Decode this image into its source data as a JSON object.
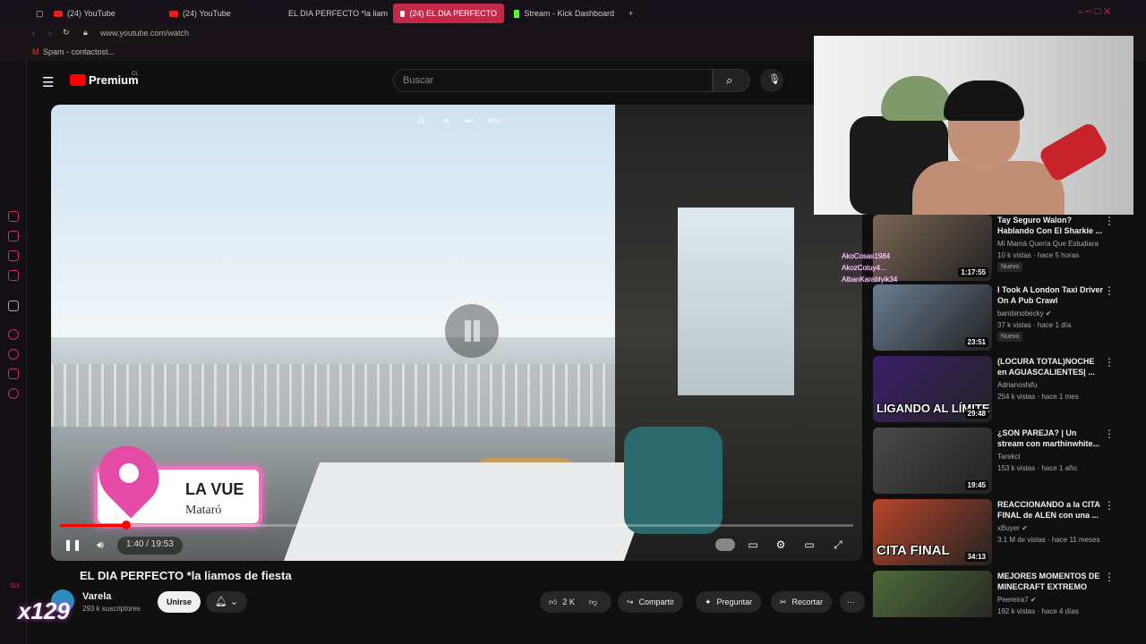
{
  "browser": {
    "tabs": [
      {
        "label": "(24) YouTube"
      },
      {
        "label": "(24) YouTube"
      },
      {
        "label": "EL DIA PERFECTO *la liam"
      },
      {
        "label": "(24) EL DIA PERFECTO"
      },
      {
        "label": "Stream - Kick Dashboard"
      }
    ],
    "new_tab": "+",
    "url": "www.youtube.com/watch",
    "bookmark": "Spam - contactost..."
  },
  "youtube": {
    "logo": "Premium",
    "country": "CL",
    "search_placeholder": "Buscar"
  },
  "video": {
    "location_name": "LA VUE",
    "location_city": "Mataró",
    "time": "1:40 / 19:53",
    "progress": 0.084,
    "mini_label": "RGX"
  },
  "below": {
    "title": "EL DIA PERFECTO *la liamos de fiesta",
    "channel": "Varela",
    "subscribers": "293 k suscriptores",
    "join": "Unirse",
    "likes": "2 K",
    "share": "Compartir",
    "ask": "Preguntar",
    "clip": "Recortar",
    "more": "⋯"
  },
  "overlay": {
    "counter": "x129",
    "gx": "GX",
    "chat": [
      "AkoCosas1984",
      "AkozCotuy4...",
      "AlbanKarablyik34"
    ]
  },
  "related": [
    {
      "title": "Tay Seguro Walon? Hablando Con El Sharkie ...",
      "channel": "Mi Mamá Quería Que Estudiara",
      "meta": "10 k vistas · hace 5 horas",
      "badge": "Nuevo",
      "duration": "1:17:55",
      "overlay": "",
      "color": "#7a6655"
    },
    {
      "title": "I Took A London Taxi Driver On A Pub Crawl",
      "channel": "bambinobecky ✔",
      "meta": "37 k vistas · hace 1 día",
      "badge": "Nuevo",
      "duration": "23:51",
      "overlay": "",
      "color": "#6b7d93"
    },
    {
      "title": "(LOCURA TOTAL)NOCHE en AGUASCALIENTES| ...",
      "channel": "Adrianoshifu",
      "meta": "254 k vistas · hace 1 mes",
      "badge": "",
      "duration": "29:48",
      "overlay": "LIGANDO AL LÍMITE",
      "color": "#3b1f6b"
    },
    {
      "title": "¿SON PAREJA? | Un stream con marthinwhite...",
      "channel": "Tarekcl",
      "meta": "153 k vistas · hace 1 año",
      "badge": "",
      "duration": "19:45",
      "overlay": "",
      "color": "#4a4a4a"
    },
    {
      "title": "REACCIONANDO a la CITA FINAL de ALEN con una ...",
      "channel": "xBuyer ✔",
      "meta": "3.1 M de vistas · hace 11 meses",
      "badge": "",
      "duration": "34:13",
      "overlay": "CITA FINAL",
      "color": "#b8452a"
    },
    {
      "title": "MEJORES MOMENTOS DE MINECRAFT EXTREMO",
      "channel": "Peereira7 ✔",
      "meta": "192 k vistas · hace 4 días",
      "badge": "",
      "duration": "",
      "overlay": "",
      "color": "#4f6a3a"
    }
  ]
}
